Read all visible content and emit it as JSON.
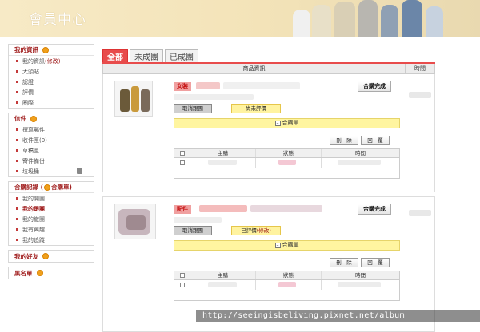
{
  "header": {
    "title": "會員中心"
  },
  "sidebar": {
    "sections": [
      {
        "title": "我的資訊",
        "items": [
          {
            "label": "我的資訊",
            "extra": "(修改)"
          },
          {
            "label": "大頭貼"
          },
          {
            "label": "認證"
          },
          {
            "label": "評價"
          },
          {
            "label": "圈際"
          }
        ]
      },
      {
        "title": "信件",
        "items": [
          {
            "label": "撰寫郵件"
          },
          {
            "label": "收件匣(0)"
          },
          {
            "label": "草稿匣"
          },
          {
            "label": "寄件備份"
          },
          {
            "label": "垃圾桶"
          }
        ]
      },
      {
        "title": "合購記錄",
        "title_extra": "合購單",
        "items": [
          {
            "label": "我的開團"
          },
          {
            "label": "我的跟團"
          },
          {
            "label": "我的撤團"
          },
          {
            "label": "我有興趣"
          },
          {
            "label": "我的追蹤"
          }
        ]
      },
      {
        "title": "我的好友",
        "items": []
      },
      {
        "title": "黑名單",
        "items": []
      }
    ]
  },
  "tabs": [
    "全部",
    "未成團",
    "已成團"
  ],
  "table_header": {
    "goods": "商品資訊",
    "time": "時間"
  },
  "orders": [
    {
      "tag": "女裝",
      "complete_btn": "合購完成",
      "cancel_btn": "取消跟團",
      "review_btn": "尚未評價",
      "group_label": "合購單",
      "delete_btn": "刪　除",
      "reply_btn": "回　覆",
      "columns": {
        "host": "主購",
        "status": "狀態",
        "time": "時間"
      }
    },
    {
      "tag": "配件",
      "complete_btn": "合購完成",
      "cancel_btn": "取消跟團",
      "review_btn": "已評價",
      "review_extra": "(修改)",
      "group_label": "合購單",
      "delete_btn": "刪　除",
      "reply_btn": "回　覆",
      "columns": {
        "host": "主購",
        "status": "狀態",
        "time": "時間"
      }
    }
  ],
  "watermark": "http://seeingisbeliving.pixnet.net/album",
  "colors": {
    "accent": "#e84c4c",
    "tag_bg": "#f0a0a0",
    "group_bar": "#fff5a0",
    "header_bg": "#f3e3b8"
  }
}
